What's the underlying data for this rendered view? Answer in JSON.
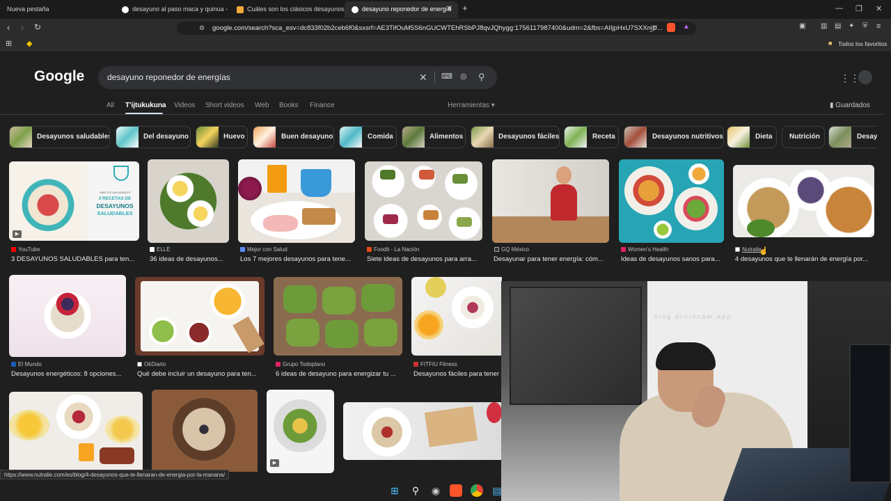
{
  "browser": {
    "tabs": [
      {
        "label": "Nueva pestaña",
        "active": false
      },
      {
        "label": "desayuno al paso maca y quinua - M",
        "active": false
      },
      {
        "label": "Cuáles son los clásicos desayunos qu",
        "active": false
      },
      {
        "label": "desayuno reponedor de energía",
        "active": true
      }
    ],
    "url": "google.com/search?sca_esv=dc833f02b2ceb6f0&sxsrf=AE3TifOuM5S6nGUCWTEhRSbPJ8qvJQhygg:1756117987400&udm=2&fbs=AIIjpHxU7SXXniU...",
    "bookmarks_label": "Todos los favoritos"
  },
  "google": {
    "logo": "Google",
    "query": "desayuno reponedor de energías",
    "tabs": [
      "All",
      "T'ijtukukuna",
      "Videos",
      "Short videos",
      "Web",
      "Books",
      "Finance"
    ],
    "tools_label": "Herramientas",
    "saved_label": "Guardados"
  },
  "chips": [
    "Desayunos saludables",
    "Del desayuno",
    "Huevo",
    "Buen desayuno",
    "Comida",
    "Alimentos",
    "Desayunos fáciles",
    "Receta",
    "Desayunos nutritivos",
    "Dieta",
    "Nutrición",
    "Desay"
  ],
  "results_row1": [
    {
      "source": "YouTube",
      "caption": "3 DESAYUNOS SALUDABLES para ten..."
    },
    {
      "source": "ELLE",
      "caption": "36 ideas de desayunos..."
    },
    {
      "source": "Mejor con Salud",
      "caption": "Los 7 mejores desayunos para tene..."
    },
    {
      "source": "Foodit - La Nación",
      "caption": "Siete ideas de desayunos para arra..."
    },
    {
      "source": "GQ México",
      "caption": "Desayunar para tener energía: cóm..."
    },
    {
      "source": "Women's Health",
      "caption": "Ideas de desayunos sanos para..."
    },
    {
      "source": "Nutralie",
      "caption": "4 desayunos que te llenarán de energía por..."
    }
  ],
  "results_row2": [
    {
      "source": "El Mundo",
      "caption": "Desayunos energéticos: 8 opciones..."
    },
    {
      "source": "OkDiario",
      "caption": "Qué debe incluir un desayuno para ten..."
    },
    {
      "source": "Grupo Todoplano",
      "caption": "6 ideas de desayuno para energizar tu ..."
    },
    {
      "source": "FITFIU Fitness",
      "caption": "Desayunos fáciles para tener"
    }
  ],
  "thumb_text": {
    "recipe_small": "HÁBITOS SALUDABLES",
    "recipe_big1": "3 RECETAS DE",
    "recipe_big2": "DESAYUNOS",
    "recipe_big3": "SALUDABLES"
  },
  "webcam_watermark": "sing droidcam.app",
  "status_url": "https://www.nutralie.com/es/blog/4-desayunos-que-te-llenaran-de-energia-por-la-manana/",
  "colors": {
    "background": "#1f1f1f",
    "chrome": "#2c2c2c",
    "accent": "#d2e3fc"
  }
}
